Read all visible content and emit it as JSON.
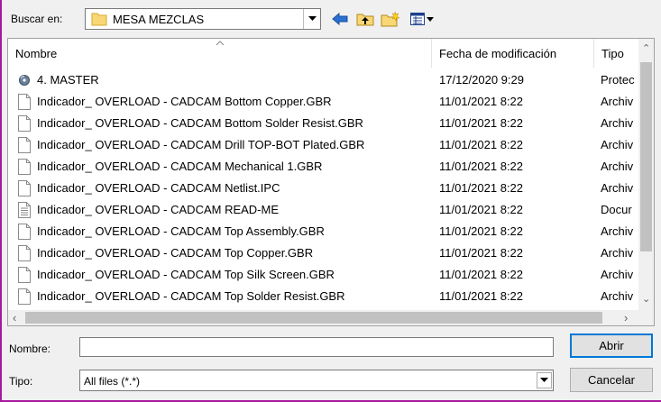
{
  "toolbar": {
    "lookin_label": "Buscar en:",
    "current_folder": "MESA MEZCLAS"
  },
  "columns": {
    "name": "Nombre",
    "modified": "Fecha de modificación",
    "type": "Tipo"
  },
  "files": [
    {
      "name": "4. MASTER",
      "date": "17/12/2020 9:29",
      "type": "Protec",
      "icon": "disc-icon"
    },
    {
      "name": "Indicador_ OVERLOAD - CADCAM Bottom Copper.GBR",
      "date": "11/01/2021 8:22",
      "type": "Archiv",
      "icon": "file-icon"
    },
    {
      "name": "Indicador_ OVERLOAD - CADCAM Bottom Solder Resist.GBR",
      "date": "11/01/2021 8:22",
      "type": "Archiv",
      "icon": "file-icon"
    },
    {
      "name": "Indicador_ OVERLOAD - CADCAM Drill TOP-BOT Plated.GBR",
      "date": "11/01/2021 8:22",
      "type": "Archiv",
      "icon": "file-icon"
    },
    {
      "name": "Indicador_ OVERLOAD - CADCAM Mechanical 1.GBR",
      "date": "11/01/2021 8:22",
      "type": "Archiv",
      "icon": "file-icon"
    },
    {
      "name": "Indicador_ OVERLOAD - CADCAM Netlist.IPC",
      "date": "11/01/2021 8:22",
      "type": "Archiv",
      "icon": "file-icon"
    },
    {
      "name": "Indicador_ OVERLOAD - CADCAM READ-ME",
      "date": "11/01/2021 8:22",
      "type": "Docur",
      "icon": "text-file-icon"
    },
    {
      "name": "Indicador_ OVERLOAD - CADCAM Top Assembly.GBR",
      "date": "11/01/2021 8:22",
      "type": "Archiv",
      "icon": "file-icon"
    },
    {
      "name": "Indicador_ OVERLOAD - CADCAM Top Copper.GBR",
      "date": "11/01/2021 8:22",
      "type": "Archiv",
      "icon": "file-icon"
    },
    {
      "name": "Indicador_ OVERLOAD - CADCAM Top Silk Screen.GBR",
      "date": "11/01/2021 8:22",
      "type": "Archiv",
      "icon": "file-icon"
    },
    {
      "name": "Indicador_ OVERLOAD - CADCAM Top Solder Resist.GBR",
      "date": "11/01/2021 8:22",
      "type": "Archiv",
      "icon": "file-icon"
    }
  ],
  "form": {
    "name_label": "Nombre:",
    "name_value": "",
    "type_label": "Tipo:",
    "type_value": "All files (*.*)",
    "open_label": "Abrir",
    "cancel_label": "Cancelar"
  },
  "colors": {
    "window_border": "#a8189e",
    "focus_blue": "#0078d7"
  }
}
